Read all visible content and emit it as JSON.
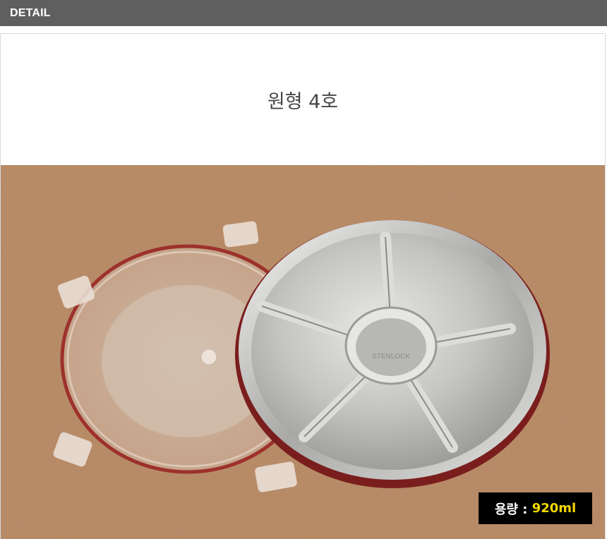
{
  "header": {
    "label": "DETAIL"
  },
  "product": {
    "title": "원형 4호"
  },
  "photo": {
    "brand_mark": "STENLOCK",
    "description_colors": {
      "background": "#b88760",
      "seal": "#9c2e2a"
    }
  },
  "capacity": {
    "label": "용량 :",
    "value": "920ml"
  },
  "colors": {
    "header_bg": "#5f5f5f",
    "badge_bg": "#000000",
    "badge_value": "#f5d800"
  }
}
